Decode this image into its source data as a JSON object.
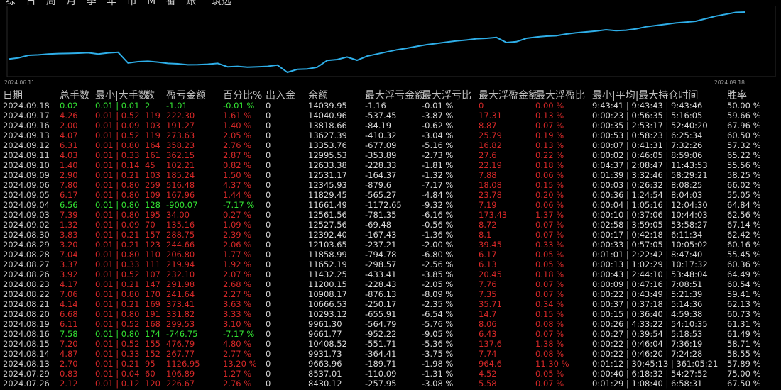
{
  "toolbar": {
    "period_tabs": "综 日 周 月 季 年 币 M 番 账",
    "mode": "筑选"
  },
  "chart_data": {
    "type": "line",
    "x_start_label": "2024.06.11",
    "x_end_label": "2024.09.18",
    "line_color": "#2eaee8",
    "values": [
      8550,
      8700,
      9000,
      9050,
      9150,
      9200,
      9220,
      9250,
      9300,
      9150,
      9280,
      9350,
      8100,
      8250,
      8300,
      8200,
      8050,
      8000,
      7880,
      7900,
      7950,
      8050,
      7650,
      7700,
      7600,
      7650,
      7700,
      7850,
      7000,
      7350,
      7400,
      7600,
      8400,
      8500,
      8800,
      8420,
      8900,
      9150,
      9400,
      9650,
      9830,
      10050,
      10250,
      10400,
      10550,
      10700,
      10800,
      10950,
      11000,
      11100,
      10500,
      10600,
      11000,
      11150,
      11250,
      11300,
      11500,
      11650,
      11750,
      11850,
      12000,
      11900,
      11950,
      12100,
      12350,
      12500,
      12650,
      12800,
      12900,
      13000,
      13300,
      13600,
      13820,
      14040,
      14080
    ],
    "ylim": [
      6500,
      14500
    ]
  },
  "headers": [
    "日期",
    "总手数",
    "最小|大手数",
    "数",
    "盈亏金额",
    "百分比%",
    "出入金",
    "余额",
    "最大浮亏金额",
    "最大浮亏比",
    "最大浮盈金额",
    "最大浮盈比",
    "最小|平均|最大持仓时间",
    "胜率"
  ],
  "colors": {
    "positive": "#d62828",
    "negative": "#33e233",
    "neutral": "#d8d8d8",
    "line": "#2eaee8",
    "grid": "#2a2a2a"
  },
  "rows": [
    {
      "date": "2024.09.18",
      "lots": "0.02",
      "minmax": "0.01 | 0.01",
      "cnt": "2",
      "pnl": "-1.01",
      "pct": "-0.01 %",
      "flow": "0",
      "bal": "14039.95",
      "mfl": "-1.16",
      "mflp": "-0.01 %",
      "mfp": "0",
      "mfpp": "0.00 %",
      "hold": "9:43:41 | 9:43:43 | 9:43:46",
      "win": "50.00 %",
      "s": "n"
    },
    {
      "date": "2024.09.17",
      "lots": "4.26",
      "minmax": "0.01 | 0.52",
      "cnt": "119",
      "pnl": "222.30",
      "pct": "1.61 %",
      "flow": "0",
      "bal": "14040.96",
      "mfl": "-537.45",
      "mflp": "-3.87 %",
      "mfp": "17.31",
      "mfpp": "0.13 %",
      "hold": "0:00:23 | 0:56:35 | 5:16:05",
      "win": "59.66 %",
      "s": "p"
    },
    {
      "date": "2024.09.16",
      "lots": "2.00",
      "minmax": "0.01 | 0.09",
      "cnt": "103",
      "pnl": "191.27",
      "pct": "1.40 %",
      "flow": "0",
      "bal": "13818.66",
      "mfl": "-84.19",
      "mflp": "-0.62 %",
      "mfp": "8.87",
      "mfpp": "0.07 %",
      "hold": "0:00:35 | 2:53:17 | 52:40:20",
      "win": "67.96 %",
      "s": "p"
    },
    {
      "date": "2024.09.13",
      "lots": "4.07",
      "minmax": "0.01 | 0.52",
      "cnt": "119",
      "pnl": "273.63",
      "pct": "2.05 %",
      "flow": "0",
      "bal": "13627.39",
      "mfl": "-410.32",
      "mflp": "-3.04 %",
      "mfp": "25.79",
      "mfpp": "0.19 %",
      "hold": "0:00:53 | 0:58:23 | 6:25:34",
      "win": "60.50 %",
      "s": "p"
    },
    {
      "date": "2024.09.12",
      "lots": "6.31",
      "minmax": "0.01 | 0.80",
      "cnt": "164",
      "pnl": "358.23",
      "pct": "2.76 %",
      "flow": "0",
      "bal": "13353.76",
      "mfl": "-677.09",
      "mflp": "-5.16 %",
      "mfp": "16.82",
      "mfpp": "0.13 %",
      "hold": "0:00:07 | 0:41:31 | 7:32:26",
      "win": "57.32 %",
      "s": "p"
    },
    {
      "date": "2024.09.11",
      "lots": "4.03",
      "minmax": "0.01 | 0.33",
      "cnt": "161",
      "pnl": "362.15",
      "pct": "2.87 %",
      "flow": "0",
      "bal": "12995.53",
      "mfl": "-353.89",
      "mflp": "-2.73 %",
      "mfp": "27.6",
      "mfpp": "0.22 %",
      "hold": "0:00:02 | 0:46:05 | 8:59:06",
      "win": "65.22 %",
      "s": "p"
    },
    {
      "date": "2024.09.10",
      "lots": "1.40",
      "minmax": "0.01 | 0.14",
      "cnt": "45",
      "pnl": "102.21",
      "pct": "0.82 %",
      "flow": "0",
      "bal": "12633.38",
      "mfl": "-228.33",
      "mflp": "-1.81 %",
      "mfp": "22.19",
      "mfpp": "0.18 %",
      "hold": "0:04:37 | 2:08:47 | 11:43:53",
      "win": "55.56 %",
      "s": "p"
    },
    {
      "date": "2024.09.09",
      "lots": "2.90",
      "minmax": "0.01 | 0.21",
      "cnt": "103",
      "pnl": "185.24",
      "pct": "1.50 %",
      "flow": "0",
      "bal": "12531.17",
      "mfl": "-164.37",
      "mflp": "-1.32 %",
      "mfp": "7.88",
      "mfpp": "0.06 %",
      "hold": "0:01:39 | 3:32:46 | 58:29:21",
      "win": "58.25 %",
      "s": "p"
    },
    {
      "date": "2024.09.06",
      "lots": "7.80",
      "minmax": "0.01 | 0.80",
      "cnt": "259",
      "pnl": "516.48",
      "pct": "4.37 %",
      "flow": "0",
      "bal": "12345.93",
      "mfl": "-879.6",
      "mflp": "-7.17 %",
      "mfp": "18.08",
      "mfpp": "0.15 %",
      "hold": "0:00:03 | 0:26:32 | 8:08:25",
      "win": "66.02 %",
      "s": "p"
    },
    {
      "date": "2024.09.05",
      "lots": "6.17",
      "minmax": "0.01 | 0.80",
      "cnt": "109",
      "pnl": "167.96",
      "pct": "1.44 %",
      "flow": "0",
      "bal": "11829.45",
      "mfl": "-565.27",
      "mflp": "-4.84 %",
      "mfp": "23.78",
      "mfpp": "0.20 %",
      "hold": "0:00:36 | 1:24:54 | 8:04:03",
      "win": "55.05 %",
      "s": "p"
    },
    {
      "date": "2024.09.04",
      "lots": "6.56",
      "minmax": "0.01 | 0.80",
      "cnt": "128",
      "pnl": "-900.07",
      "pct": "-7.17 %",
      "flow": "0",
      "bal": "11661.49",
      "mfl": "-1172.65",
      "mflp": "-9.32 %",
      "mfp": "7.19",
      "mfpp": "0.06 %",
      "hold": "0:00:04 | 1:05:16 | 12:04:30",
      "win": "64.84 %",
      "s": "n"
    },
    {
      "date": "2024.09.03",
      "lots": "7.39",
      "minmax": "0.01 | 0.80",
      "cnt": "195",
      "pnl": "34.00",
      "pct": "0.27 %",
      "flow": "0",
      "bal": "12561.56",
      "mfl": "-781.35",
      "mflp": "-6.16 %",
      "mfp": "173.43",
      "mfpp": "1.37 %",
      "hold": "0:00:10 | 0:37:06 | 10:44:03",
      "win": "62.56 %",
      "s": "p"
    },
    {
      "date": "2024.09.02",
      "lots": "1.32",
      "minmax": "0.01 | 0.09",
      "cnt": "70",
      "pnl": "135.16",
      "pct": "1.09 %",
      "flow": "0",
      "bal": "12527.56",
      "mfl": "-69.48",
      "mflp": "-0.56 %",
      "mfp": "8.72",
      "mfpp": "0.07 %",
      "hold": "0:02:58 | 3:59:05 | 53:58:27",
      "win": "67.14 %",
      "s": "p"
    },
    {
      "date": "2024.08.30",
      "lots": "3.83",
      "minmax": "0.01 | 0.21",
      "cnt": "157",
      "pnl": "288.75",
      "pct": "2.39 %",
      "flow": "0",
      "bal": "12392.40",
      "mfl": "-167.43",
      "mflp": "-1.36 %",
      "mfp": "8.1",
      "mfpp": "0.07 %",
      "hold": "0:00:17 | 0:42:18 | 6:11:34",
      "win": "62.42 %",
      "s": "p"
    },
    {
      "date": "2024.08.29",
      "lots": "3.20",
      "minmax": "0.01 | 0.21",
      "cnt": "123",
      "pnl": "244.66",
      "pct": "2.06 %",
      "flow": "0",
      "bal": "12103.65",
      "mfl": "-237.21",
      "mflp": "-2.00 %",
      "mfp": "39.45",
      "mfpp": "0.33 %",
      "hold": "0:00:33 | 0:57:05 | 10:05:02",
      "win": "60.16 %",
      "s": "p"
    },
    {
      "date": "2024.08.28",
      "lots": "7.04",
      "minmax": "0.01 | 0.80",
      "cnt": "110",
      "pnl": "206.80",
      "pct": "1.77 %",
      "flow": "0",
      "bal": "11858.99",
      "mfl": "-794.78",
      "mflp": "-6.80 %",
      "mfp": "6.17",
      "mfpp": "0.05 %",
      "hold": "0:01:01 | 2:22:42 | 8:47:40",
      "win": "55.45 %",
      "s": "p"
    },
    {
      "date": "2024.08.27",
      "lots": "3.37",
      "minmax": "0.01 | 0.33",
      "cnt": "111",
      "pnl": "219.94",
      "pct": "1.92 %",
      "flow": "0",
      "bal": "11652.19",
      "mfl": "-298.57",
      "mflp": "-2.56 %",
      "mfp": "6.13",
      "mfpp": "0.05 %",
      "hold": "0:00:13 | 1:02:29 | 10:17:32",
      "win": "60.36 %",
      "s": "p"
    },
    {
      "date": "2024.08.26",
      "lots": "3.92",
      "minmax": "0.01 | 0.52",
      "cnt": "107",
      "pnl": "232.10",
      "pct": "2.07 %",
      "flow": "0",
      "bal": "11432.25",
      "mfl": "-433.41",
      "mflp": "-3.85 %",
      "mfp": "20.45",
      "mfpp": "0.18 %",
      "hold": "0:00:43 | 2:44:10 | 53:48:04",
      "win": "64.49 %",
      "s": "p"
    },
    {
      "date": "2024.08.23",
      "lots": "4.17",
      "minmax": "0.01 | 0.21",
      "cnt": "147",
      "pnl": "291.98",
      "pct": "2.68 %",
      "flow": "0",
      "bal": "11200.15",
      "mfl": "-228.43",
      "mflp": "-2.05 %",
      "mfp": "7.76",
      "mfpp": "0.07 %",
      "hold": "0:00:09 | 0:47:16 | 7:08:51",
      "win": "60.54 %",
      "s": "p"
    },
    {
      "date": "2024.08.22",
      "lots": "7.06",
      "minmax": "0.01 | 0.80",
      "cnt": "170",
      "pnl": "241.64",
      "pct": "2.27 %",
      "flow": "0",
      "bal": "10908.17",
      "mfl": "-876.13",
      "mflp": "-8.09 %",
      "mfp": "7.35",
      "mfpp": "0.07 %",
      "hold": "0:00:22 | 0:43:49 | 5:21:39",
      "win": "59.41 %",
      "s": "p"
    },
    {
      "date": "2024.08.21",
      "lots": "4.14",
      "minmax": "0.01 | 0.21",
      "cnt": "169",
      "pnl": "373.41",
      "pct": "3.63 %",
      "flow": "0",
      "bal": "10666.53",
      "mfl": "-250.17",
      "mflp": "-2.35 %",
      "mfp": "35.71",
      "mfpp": "0.34 %",
      "hold": "0:00:37 | 0:37:18 | 5:14:36",
      "win": "62.13 %",
      "s": "p"
    },
    {
      "date": "2024.08.20",
      "lots": "6.68",
      "minmax": "0.01 | 0.80",
      "cnt": "191",
      "pnl": "331.82",
      "pct": "3.33 %",
      "flow": "0",
      "bal": "10293.12",
      "mfl": "-655.91",
      "mflp": "-6.54 %",
      "mfp": "14.7",
      "mfpp": "0.15 %",
      "hold": "0:00:15 | 0:36:40 | 4:59:38",
      "win": "60.73 %",
      "s": "p"
    },
    {
      "date": "2024.08.19",
      "lots": "6.11",
      "minmax": "0.01 | 0.52",
      "cnt": "168",
      "pnl": "299.53",
      "pct": "3.10 %",
      "flow": "0",
      "bal": "9961.30",
      "mfl": "-564.79",
      "mflp": "-5.76 %",
      "mfp": "8.06",
      "mfpp": "0.08 %",
      "hold": "0:00:26 | 4:33:22 | 54:10:35",
      "win": "61.31 %",
      "s": "p"
    },
    {
      "date": "2024.08.16",
      "lots": "7.58",
      "minmax": "0.01 | 0.80",
      "cnt": "174",
      "pnl": "-746.75",
      "pct": "-7.17 %",
      "flow": "0",
      "bal": "9661.77",
      "mfl": "-952.22",
      "mflp": "-9.05 %",
      "mfp": "6.43",
      "mfpp": "0.07 %",
      "hold": "0:00:27 | 0:39:54 | 5:18:53",
      "win": "61.49 %",
      "s": "n"
    },
    {
      "date": "2024.08.15",
      "lots": "7.20",
      "minmax": "0.01 | 0.52",
      "cnt": "155",
      "pnl": "476.79",
      "pct": "4.80 %",
      "flow": "0",
      "bal": "10408.52",
      "mfl": "-551.71",
      "mflp": "-5.36 %",
      "mfp": "137.6",
      "mfpp": "1.38 %",
      "hold": "0:00:22 | 0:46:04 | 7:36:19",
      "win": "58.71 %",
      "s": "p"
    },
    {
      "date": "2024.08.14",
      "lots": "4.87",
      "minmax": "0.01 | 0.33",
      "cnt": "152",
      "pnl": "267.77",
      "pct": "2.77 %",
      "flow": "0",
      "bal": "9931.73",
      "mfl": "-364.41",
      "mflp": "-3.75 %",
      "mfp": "7.74",
      "mfpp": "0.08 %",
      "hold": "0:00:22 | 0:46:20 | 7:24:28",
      "win": "58.55 %",
      "s": "p"
    },
    {
      "date": "2024.08.13",
      "lots": "2.70",
      "minmax": "0.01 | 0.21",
      "cnt": "95",
      "pnl": "1126.95",
      "pct": "13.20 %",
      "flow": "0",
      "bal": "9663.96",
      "mfl": "-189.71",
      "mflp": "-1.98 %",
      "mfp": "964.6",
      "mfpp": "11.30 %",
      "hold": "0:01:12 | 30:45:13 | 361:05:21",
      "win": "57.89 %",
      "s": "p"
    },
    {
      "date": "2024.07.29",
      "lots": "0.83",
      "minmax": "0.01 | 0.04",
      "cnt": "60",
      "pnl": "106.89",
      "pct": "1.27 %",
      "flow": "0",
      "bal": "8537.01",
      "mfl": "-110.09",
      "mflp": "-1.31 %",
      "mfp": "4.52",
      "mfpp": "0.05 %",
      "hold": "0:00:40 | 6:18:32 | 54:27:52",
      "win": "75.00 %",
      "s": "p"
    },
    {
      "date": "2024.07.26",
      "lots": "2.12",
      "minmax": "0.01 | 0.12",
      "cnt": "120",
      "pnl": "226.67",
      "pct": "2.76 %",
      "flow": "0",
      "bal": "8430.12",
      "mfl": "-257.95",
      "mflp": "-3.08 %",
      "mfp": "5.58",
      "mfpp": "0.07 %",
      "hold": "0:01:29 | 1:08:40 | 6:58:31",
      "win": "67.50 %",
      "s": "p"
    }
  ]
}
